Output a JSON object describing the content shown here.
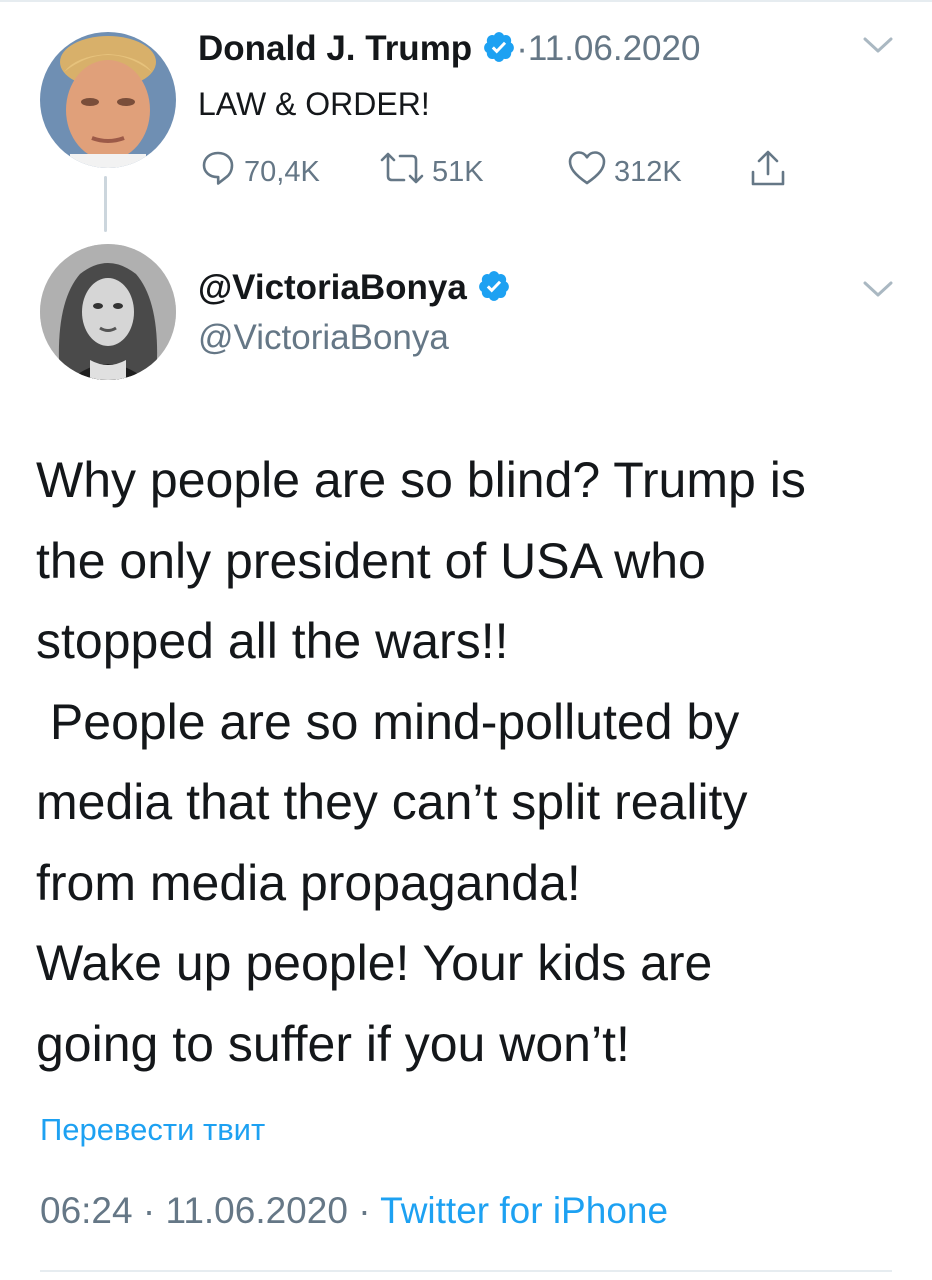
{
  "tweet1": {
    "name": "Donald J. Trump",
    "separator": " · ",
    "date": "11.06.2020",
    "text": "LAW & ORDER!",
    "replies": "70,4K",
    "retweets": "51K",
    "likes": "312K"
  },
  "tweet2": {
    "display_name": "@VictoriaBonya",
    "handle": "@VictoriaBonya",
    "body": "Why people are so blind? Trump is\nthe only president of USA who\nstopped all the wars!!\n People are so mind-polluted by\nmedia that they can’t split reality\nfrom media propaganda!\nWake up people! Your kids are\ngoing to suffer if you won’t!",
    "translate_label": "Перевести твит",
    "time": "06:24",
    "date": "11.06.2020",
    "source": "Twitter for iPhone"
  },
  "icons": {
    "verified": "verified-badge-icon",
    "reply": "speech-bubble-icon",
    "retweet": "retweet-arrows-icon",
    "like": "heart-icon",
    "share": "share-upload-icon",
    "more": "chevron-down-icon"
  },
  "colors": {
    "accent": "#1da1f2",
    "secondary_text": "#657786",
    "primary_text": "#14171a"
  }
}
